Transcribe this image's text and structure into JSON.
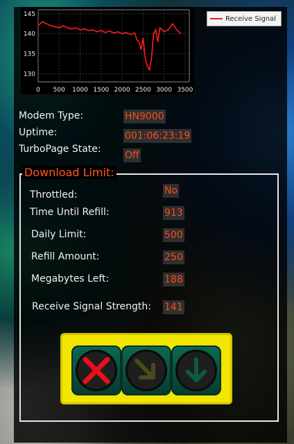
{
  "chart_data": {
    "type": "line",
    "series": [
      {
        "name": "Receive Signal",
        "color": "#ff1e1e",
        "points": [
          [
            0,
            142
          ],
          [
            100,
            143
          ],
          [
            200,
            142.5
          ],
          [
            300,
            142
          ],
          [
            400,
            141.8
          ],
          [
            500,
            141.5
          ],
          [
            600,
            142
          ],
          [
            700,
            141.5
          ],
          [
            800,
            141.2
          ],
          [
            900,
            141.5
          ],
          [
            1000,
            141
          ],
          [
            1100,
            141.2
          ],
          [
            1200,
            140.8
          ],
          [
            1300,
            141
          ],
          [
            1400,
            140.5
          ],
          [
            1500,
            140.8
          ],
          [
            1600,
            140.3
          ],
          [
            1700,
            140.7
          ],
          [
            1800,
            140.2
          ],
          [
            1900,
            140.5
          ],
          [
            2000,
            140
          ],
          [
            2100,
            140.3
          ],
          [
            2200,
            139.8
          ],
          [
            2300,
            140.2
          ],
          [
            2350,
            138.5
          ],
          [
            2400,
            138
          ],
          [
            2450,
            136
          ],
          [
            2500,
            139
          ],
          [
            2550,
            134
          ],
          [
            2600,
            132
          ],
          [
            2650,
            131
          ],
          [
            2700,
            134
          ],
          [
            2750,
            140
          ],
          [
            2800,
            141
          ],
          [
            2850,
            138
          ],
          [
            2900,
            141.5
          ],
          [
            3000,
            140.5
          ],
          [
            3100,
            141
          ],
          [
            3200,
            142.5
          ],
          [
            3300,
            141
          ],
          [
            3400,
            140
          ]
        ]
      }
    ],
    "xlim": [
      0,
      3600
    ],
    "ylim": [
      128,
      146
    ],
    "xticks": [
      0,
      500,
      1000,
      1500,
      2000,
      2500,
      3000,
      3500
    ],
    "yticks": [
      145,
      140,
      135,
      130
    ],
    "grid": true,
    "legend": "top-right"
  },
  "legend_label": "Receive Signal",
  "status": {
    "modem_type_label": "Modem Type:",
    "modem_type_value": "HN9000",
    "uptime_label": "Uptime:",
    "uptime_value": "001:06:23:19",
    "turbopage_label": "TurboPage State:",
    "turbopage_value": "Off"
  },
  "download_limit": {
    "title": "Download Limit:",
    "throttled_label": "Throttled:",
    "throttled_value": "No",
    "refill_time_label": "Time Until Refill:",
    "refill_time_value": "913",
    "daily_limit_label": "Daily Limit:",
    "daily_limit_value": "500",
    "refill_amount_label": "Refill Amount:",
    "refill_amount_value": "250",
    "mb_left_label": "Megabytes Left:",
    "mb_left_value": "188",
    "signal_label": "Receive Signal Strength:",
    "signal_value": "141"
  },
  "traffic_light": {
    "lamps": [
      {
        "name": "x-mark-icon",
        "state": "on",
        "color": "#e8101a"
      },
      {
        "name": "arrow-down-right-icon",
        "state": "off",
        "color": "#4a4a1a"
      },
      {
        "name": "arrow-down-icon",
        "state": "off",
        "color": "#0e5a44"
      }
    ]
  }
}
